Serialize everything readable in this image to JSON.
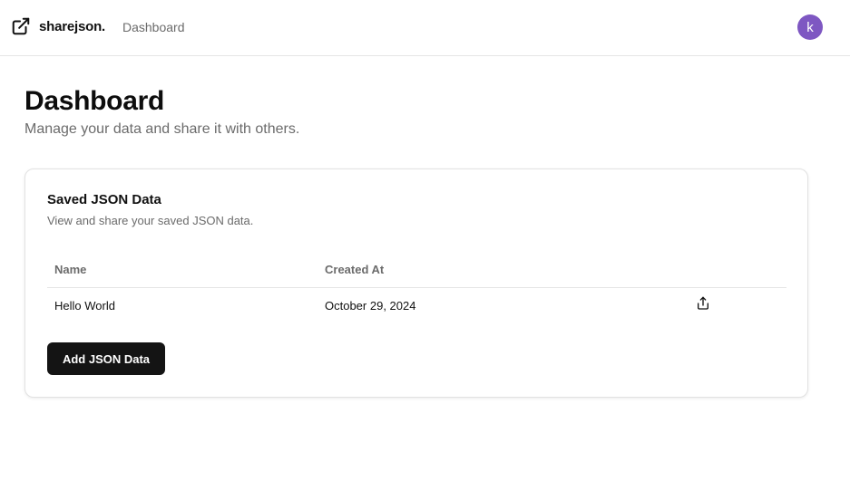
{
  "header": {
    "brand_name": "sharejson.",
    "brand_icon": "external-link-icon",
    "nav_link": "Dashboard",
    "avatar_initial": "k",
    "avatar_color": "#7e57c2"
  },
  "page": {
    "title": "Dashboard",
    "subtitle": "Manage your data and share it with others."
  },
  "card": {
    "title": "Saved JSON Data",
    "description": "View and share your saved JSON data.",
    "table": {
      "columns": [
        "Name",
        "Created At"
      ],
      "rows": [
        {
          "name": "Hello World",
          "created_at": "October 29, 2024",
          "action_icon": "share-icon"
        }
      ]
    },
    "add_button_label": "Add JSON Data"
  }
}
